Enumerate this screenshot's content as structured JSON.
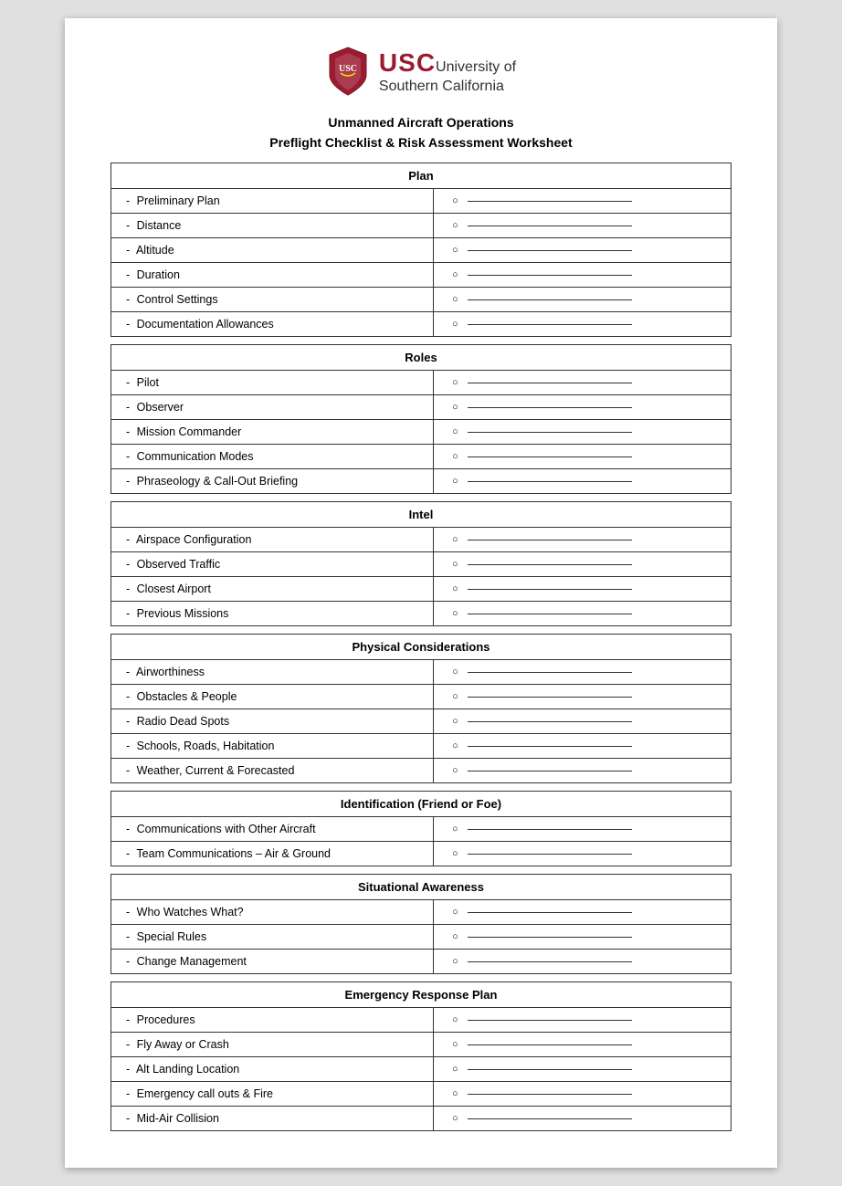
{
  "header": {
    "usc_text": "USC",
    "university_line1": "University of",
    "university_line2": "Southern California"
  },
  "doc_title": "Unmanned Aircraft Operations",
  "doc_subtitle": "Preflight Checklist & Risk Assessment Worksheet",
  "sections": [
    {
      "id": "plan",
      "title": "Plan",
      "items": [
        "Preliminary Plan",
        "Distance",
        "Altitude",
        "Duration",
        "Control Settings",
        "Documentation Allowances"
      ]
    },
    {
      "id": "roles",
      "title": "Roles",
      "items": [
        "Pilot",
        "Observer",
        "Mission Commander",
        "Communication Modes",
        "Phraseology & Call-Out Briefing"
      ]
    },
    {
      "id": "intel",
      "title": "Intel",
      "items": [
        "Airspace Configuration",
        "Observed Traffic",
        "Closest Airport",
        "Previous Missions"
      ]
    },
    {
      "id": "physical",
      "title": "Physical Considerations",
      "items": [
        "Airworthiness",
        "Obstacles & People",
        "Radio Dead Spots",
        "Schools, Roads, Habitation",
        "Weather, Current & Forecasted"
      ]
    },
    {
      "id": "identification",
      "title": "Identification (Friend or Foe)",
      "items": [
        "Communications with Other Aircraft",
        "Team Communications – Air & Ground"
      ]
    },
    {
      "id": "situational",
      "title": "Situational Awareness",
      "items": [
        "Who Watches What?",
        "Special Rules",
        "Change Management"
      ]
    },
    {
      "id": "emergency",
      "title": "Emergency Response Plan",
      "items": [
        "Procedures",
        "Fly Away or Crash",
        "Alt Landing Location",
        "Emergency call outs & Fire",
        "Mid-Air Collision"
      ]
    }
  ]
}
